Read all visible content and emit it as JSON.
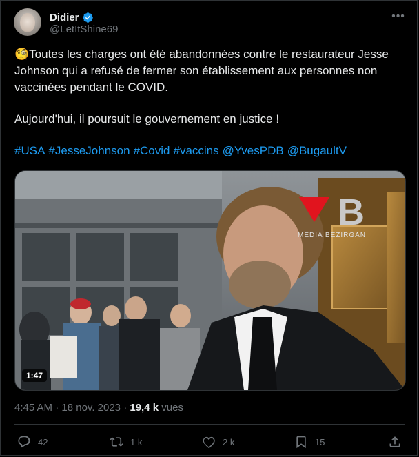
{
  "author": {
    "name": "Didier",
    "handle": "@LetItShine69",
    "verified": true
  },
  "tweet": {
    "emoji": "🧐",
    "paragraph1": "Toutes les charges ont été abandonnées contre le restaurateur Jesse Johnson qui a refusé de fermer son établissement aux personnes non vaccinées pendant le COVID.",
    "paragraph2": "Aujourd'hui, il poursuit le gouvernement en justice !",
    "tags": [
      "#USA",
      "#JesseJohnson",
      "#Covid",
      "#vaccins",
      "@YvesPDB",
      "@BugaultV"
    ]
  },
  "media": {
    "duration": "1:47",
    "watermark_letter": "B",
    "watermark_sub": "MEDIA BEZIRGAN"
  },
  "meta": {
    "time": "4:45 AM",
    "separator": "·",
    "date": "18 nov. 2023",
    "views_count": "19,4 k",
    "views_label": "vues"
  },
  "actions": {
    "replies": "42",
    "reposts": "1 k",
    "likes": "2 k",
    "bookmarks": "15"
  },
  "colors": {
    "accent": "#1d9bf0",
    "muted": "#71767b",
    "text": "#e7e9ea",
    "background": "#000000",
    "border": "#2f3336"
  }
}
